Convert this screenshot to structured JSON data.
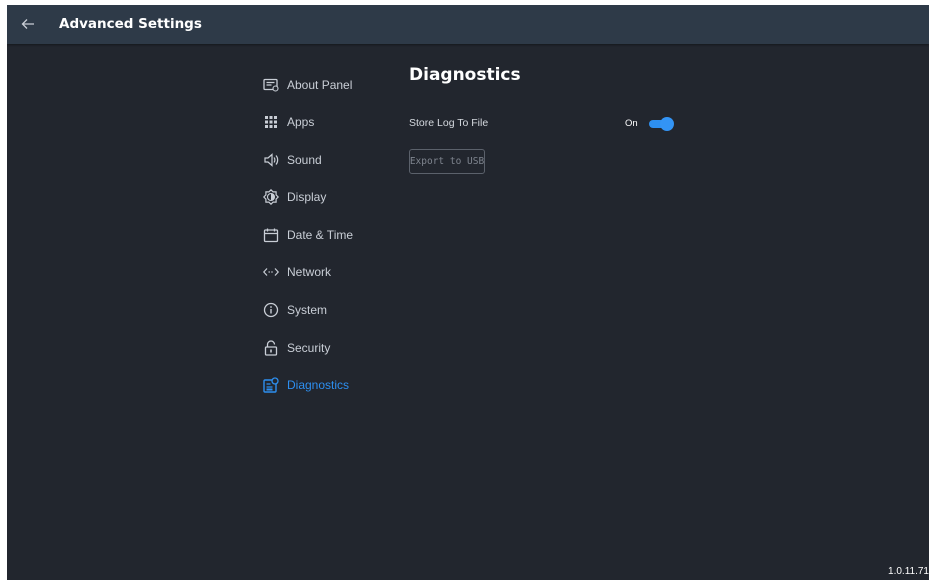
{
  "header": {
    "title": "Advanced Settings",
    "back_icon": "arrow-left-icon"
  },
  "sidebar": {
    "items": [
      {
        "label": "About Panel",
        "icon": "panel-info-icon",
        "active": false
      },
      {
        "label": "Apps",
        "icon": "apps-grid-icon",
        "active": false
      },
      {
        "label": "Sound",
        "icon": "speaker-icon",
        "active": false
      },
      {
        "label": "Display",
        "icon": "brightness-icon",
        "active": false
      },
      {
        "label": "Date & Time",
        "icon": "calendar-icon",
        "active": false
      },
      {
        "label": "Network",
        "icon": "network-icon",
        "active": false
      },
      {
        "label": "System",
        "icon": "info-icon",
        "active": false
      },
      {
        "label": "Security",
        "icon": "lock-icon",
        "active": false
      },
      {
        "label": "Diagnostics",
        "icon": "diagnostics-icon",
        "active": true
      }
    ]
  },
  "main": {
    "heading": "Diagnostics",
    "store_log": {
      "label": "Store Log To File",
      "state_label": "On",
      "enabled": true
    },
    "export_button": "Export to USB"
  },
  "version": "1.0.11.71",
  "colors": {
    "background": "#22262e",
    "header": "#2e3a48",
    "accent": "#2d8ff0",
    "text": "#c9ced6"
  }
}
